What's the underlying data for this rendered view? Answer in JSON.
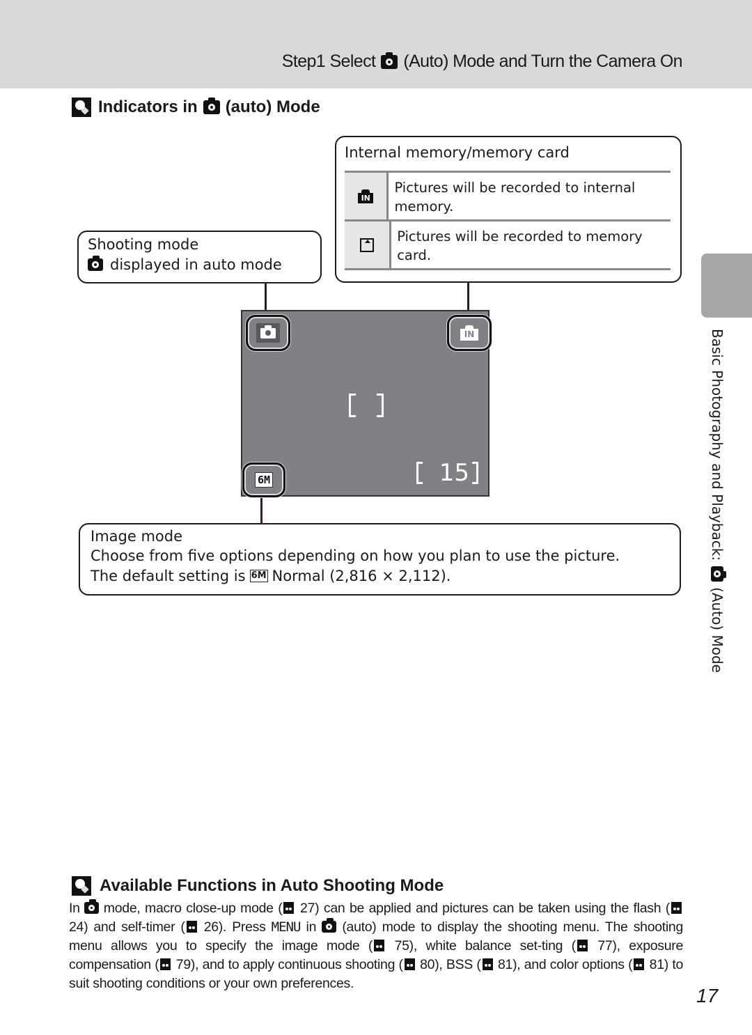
{
  "header": {
    "step_prefix": "Step1 Select",
    "step_suffix": "(Auto) Mode and Turn the Camera On"
  },
  "section": {
    "title_prefix": "Indicators in",
    "title_suffix": "(auto) Mode"
  },
  "memory_callout": {
    "title": "Internal memory/memory card",
    "rows": [
      {
        "icon": "internal-memory-icon",
        "icon_text": "IN",
        "text": "Pictures will be recorded to internal memory."
      },
      {
        "icon": "memory-card-icon",
        "icon_text": "",
        "text": "Pictures will be recorded to memory card."
      }
    ]
  },
  "shooting_callout": {
    "line1": "Shooting mode",
    "line2": "displayed in auto mode"
  },
  "lcd": {
    "shooting_mode_icon": "camera-icon",
    "memory_icon_text": "IN",
    "image_mode_text": "6M",
    "exposures_remaining": "15"
  },
  "image_callout": {
    "line1": "Image mode",
    "line2": "Choose from five options depending on how you plan to use the picture.",
    "line3_prefix": "The default setting is",
    "line3_icon_text": "6M",
    "line3_suffix": "Normal (2,816 × 2,112)."
  },
  "side_tab": {
    "text_prefix": "Basic Photography and Playback:",
    "text_suffix": "(Auto) Mode"
  },
  "tips": {
    "title": "Available Functions in Auto Shooting Mode",
    "p": {
      "a": "In",
      "b": "mode, macro close-up mode (",
      "c": "27) can be applied and pictures can be taken using the flash (",
      "d": "24) and self-timer (",
      "e": "26). Press",
      "menu": "MENU",
      "f": "in",
      "g": "(auto) mode to display the shooting menu. The shooting menu allows you to specify the image mode (",
      "h": "75), white balance set-ting (",
      "i": "77), exposure compensation (",
      "j": "79), and to apply continuous shooting (",
      "k": "80), BSS (",
      "l": "81), and color options (",
      "m": "81) to suit shooting conditions or your own preferences."
    }
  },
  "page_number": "17",
  "colors": {
    "header_band": "#d9d9d9",
    "lcd_background": "#808184",
    "side_tab": "#a6a6a6",
    "table_rule": "#888888"
  }
}
